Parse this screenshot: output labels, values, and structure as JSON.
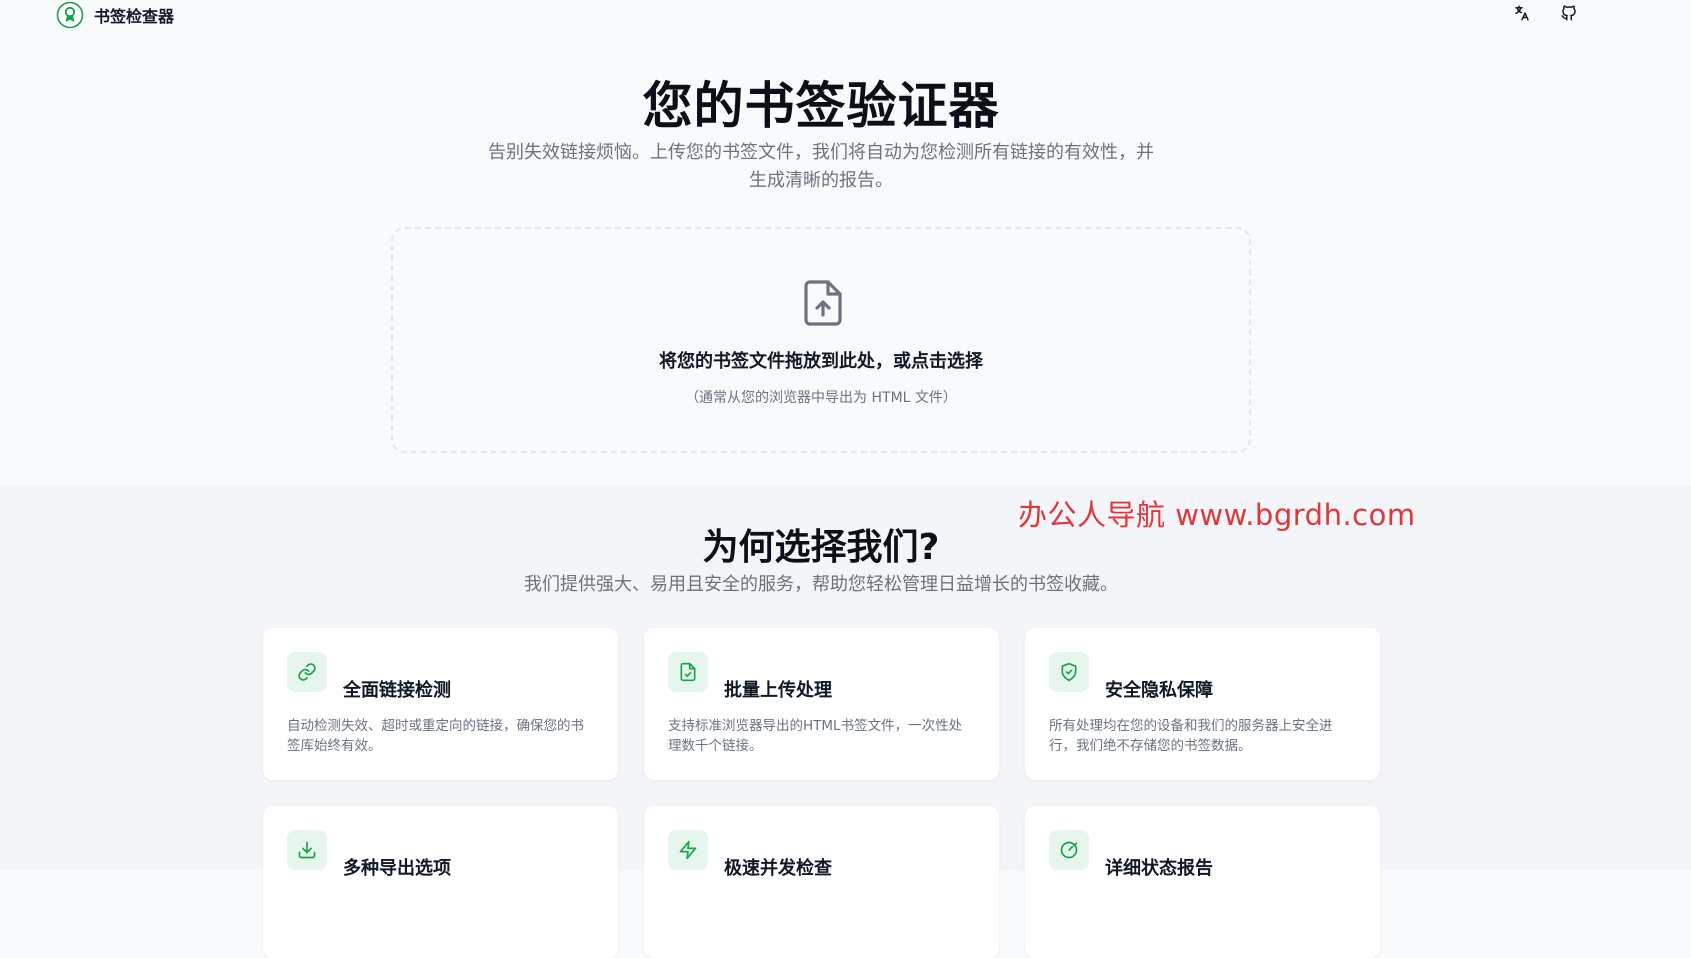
{
  "header": {
    "brand_name": "书签检查器",
    "icons": {
      "logo": "ribbon-logo-icon",
      "language": "translate-icon",
      "github": "github-icon"
    }
  },
  "hero": {
    "title": "您的书签验证器",
    "subtitle": "告别失效链接烦恼。上传您的书签文件，我们将自动为您检测所有链接的有效性，并生成清晰的报告。"
  },
  "dropzone": {
    "icon": "file-upload-icon",
    "main_text": "将您的书签文件拖放到此处，或点击选择",
    "hint_text": "（通常从您的浏览器中导出为 HTML 文件）"
  },
  "watermark": "办公人导航  www.bgrdh.com",
  "why": {
    "title": "为何选择我们?",
    "subtitle": "我们提供强大、易用且安全的服务，帮助您轻松管理日益增长的书签收藏。",
    "features": [
      {
        "icon": "link-icon",
        "title": "全面链接检测",
        "description": "自动检测失效、超时或重定向的链接，确保您的书签库始终有效。"
      },
      {
        "icon": "file-check-icon",
        "title": "批量上传处理",
        "description": "支持标准浏览器导出的HTML书签文件，一次性处理数千个链接。"
      },
      {
        "icon": "shield-check-icon",
        "title": "安全隐私保障",
        "description": "所有处理均在您的设备和我们的服务器上安全进行，我们绝不存储您的书签数据。"
      },
      {
        "icon": "download-icon",
        "title": "多种导出选项",
        "description": ""
      },
      {
        "icon": "lightning-icon",
        "title": "极速并发检查",
        "description": ""
      },
      {
        "icon": "gauge-icon",
        "title": "详细状态报告",
        "description": ""
      }
    ]
  },
  "colors": {
    "accent": "#16a34a",
    "icon_bg": "#e7f6ec",
    "watermark": "#e0383a"
  }
}
